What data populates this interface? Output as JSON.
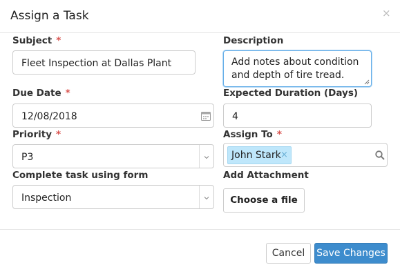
{
  "modal": {
    "title": "Assign a Task",
    "close_glyph": "×"
  },
  "fields": {
    "required_marker": "*",
    "subject": {
      "label": "Subject",
      "value": "Fleet Inspection at Dallas Plant"
    },
    "description": {
      "label": "Description",
      "value": "Add notes about condition and depth of tire tread."
    },
    "due_date": {
      "label": "Due Date",
      "value": "12/08/2018"
    },
    "expected_duration": {
      "label": "Expected Duration (Days)",
      "value": "4"
    },
    "priority": {
      "label": "Priority",
      "selected": "P3"
    },
    "assign_to": {
      "label": "Assign To",
      "tags": [
        "John Stark"
      ],
      "tag_remove_glyph": "×"
    },
    "complete_form": {
      "label": "Complete task using form",
      "selected": "Inspection"
    },
    "attachment": {
      "label": "Add Attachment",
      "button_label": "Choose a file"
    }
  },
  "footer": {
    "cancel_label": "Cancel",
    "save_label": "Save Changes"
  },
  "colors": {
    "required": "#d9534f",
    "primary_button": "#3d8ccd",
    "tag_background": "#bfe7fb",
    "focus_border": "#66afe9"
  },
  "icons": [
    "close-icon",
    "calendar-icon",
    "chevron-down-icon",
    "search-icon",
    "tag-remove-icon",
    "resize-handle-icon"
  ]
}
